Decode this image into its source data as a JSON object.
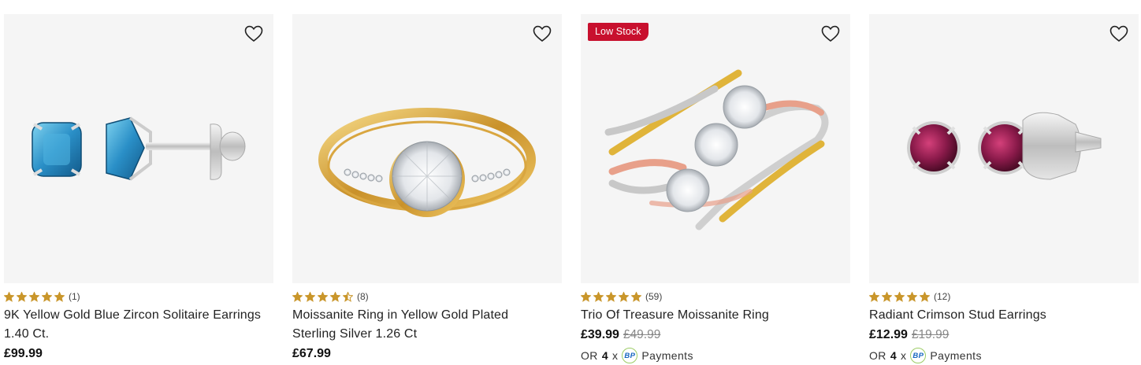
{
  "products": [
    {
      "title": "9K Yellow Gold Blue Zircon Solitaire Earrings 1.40 Ct.",
      "rating": 5,
      "reviews": "(1)",
      "price": "£99.99",
      "was": "",
      "badge": "",
      "payments": null
    },
    {
      "title": "Moissanite Ring in Yellow Gold Plated Sterling Silver 1.26 Ct",
      "rating": 4.5,
      "reviews": "(8)",
      "price": "£67.99",
      "was": "",
      "badge": "",
      "payments": null
    },
    {
      "title": "Trio Of Treasure Moissanite Ring",
      "rating": 5,
      "reviews": "(59)",
      "price": "£39.99",
      "was": "£49.99",
      "badge": "Low Stock",
      "payments": {
        "or": "OR",
        "count": "4",
        "x": "x",
        "logo": "BP",
        "label": "Payments"
      }
    },
    {
      "title": "Radiant Crimson Stud Earrings",
      "rating": 5,
      "reviews": "(12)",
      "price": "£12.99",
      "was": "£19.99",
      "badge": "",
      "payments": {
        "or": "OR",
        "count": "4",
        "x": "x",
        "logo": "BP",
        "label": "Payments"
      }
    }
  ],
  "icons": {
    "wishlist": "heart-outline-icon",
    "star": "star-icon"
  },
  "colors": {
    "star": "#c9962b",
    "badge": "#c8102e",
    "image_bg": "#f5f5f5"
  }
}
